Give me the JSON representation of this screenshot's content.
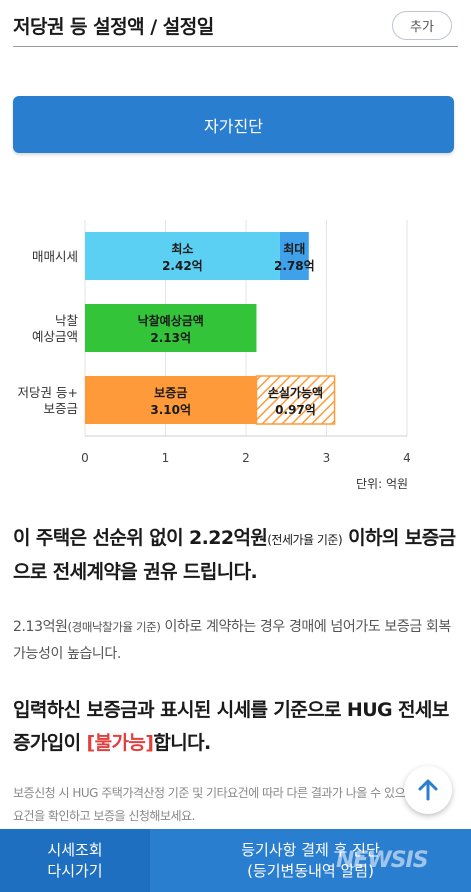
{
  "header": {
    "title": "저당권 등 설정액 / 설정일",
    "add_label": "추가"
  },
  "diagnosis_button": {
    "label": "자가진단"
  },
  "chart_data": {
    "type": "bar",
    "orientation": "horizontal",
    "stacked": true,
    "categories": [
      "매매시세",
      "낙찰\n예상금액",
      "저당권 등+\n보증금"
    ],
    "segments": [
      {
        "category": "매매시세",
        "start": 0,
        "end": 2.42,
        "label": "최소",
        "value_label": "2.42억",
        "color": "#5bd0f2"
      },
      {
        "category": "매매시세",
        "start": 2.42,
        "end": 2.78,
        "label": "최대",
        "value_label": "2.78억",
        "color": "#3ea1ea"
      },
      {
        "category": "낙찰\n예상금액",
        "start": 0,
        "end": 2.13,
        "label": "낙찰예상금액",
        "value_label": "2.13억",
        "color": "#33c43a"
      },
      {
        "category": "저당권 등+\n보증금",
        "start": 0,
        "end": 2.13,
        "label": "보증금",
        "value_label": "3.10억",
        "color": "#ff9a3a"
      },
      {
        "category": "저당권 등+\n보증금",
        "start": 2.13,
        "end": 3.1,
        "label": "손실가능액",
        "value_label": "0.97억",
        "color": "#ff9a3a",
        "pattern": "hatched"
      }
    ],
    "xlim": [
      0,
      4
    ],
    "xticks": [
      0,
      1,
      2,
      3,
      4
    ],
    "grid": true,
    "unit_label": "단위: 억원"
  },
  "main_message": {
    "prefix": "이 주택은 선순위 없이 2.22억원",
    "note": "(전세가율 기준)",
    "suffix": " 이하의 보증금으로 전세계약을 권유 드립니다."
  },
  "sub_message": {
    "amount": "2.13억원",
    "note": "(경매낙찰가율 기준)",
    "suffix": " 이하로 계약하는 경우 경매에 넘어가도 보증금 회복 가능성이 높습니다."
  },
  "hug_message": {
    "prefix": "입력하신 보증금과 표시된 시세를 기준으로 HUG 전세보증가입이 ",
    "status": "[불가능]",
    "suffix": "합니다."
  },
  "note": "보증신청 시 HUG 주택가격산정 기준 및 기타요건에 따라 다른 결과가 나올 수 있으니 가입요건을 확인하고 보증을 신청해보세요.",
  "bottom_bar": {
    "recheck_line1": "시세조회",
    "recheck_line2": "다시가기",
    "pay_line1": "등기사항 결제 후 진단",
    "pay_line2": "(등기변동내역 알림)"
  },
  "watermark": "NEWSIS",
  "colors": {
    "primary": "#2a7ed0",
    "primary_dark": "#1f6fc0",
    "danger": "#e0413f"
  }
}
